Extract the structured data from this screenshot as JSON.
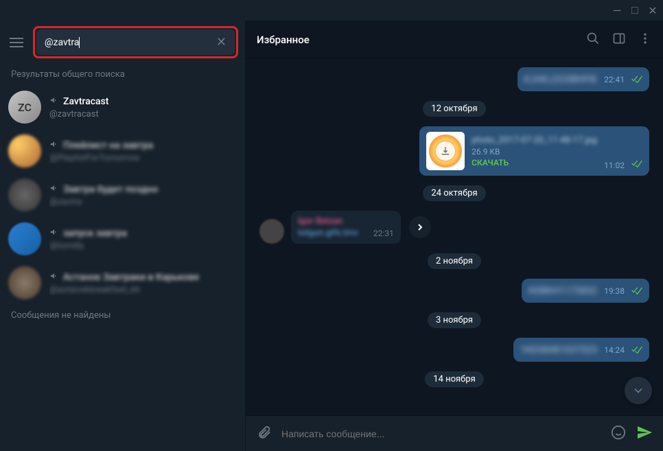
{
  "titlebar": {
    "min": "—",
    "max": "□",
    "close": "✕"
  },
  "search": {
    "value": "@zavtra",
    "clear": "✕"
  },
  "sidebar": {
    "results_header": "Результаты общего поиска",
    "no_messages": "Сообщения не найдены",
    "items": [
      {
        "title": "Zavtracast",
        "handle": "@zavtracast",
        "avatar_text": "ZC"
      },
      {
        "title": "Плейлист на завтра",
        "handle": "@PlaylistForTomorrow"
      },
      {
        "title": "Завтра будет поздно",
        "handle": "@zavtra"
      },
      {
        "title": "запуск завтра",
        "handle": "@tomilly"
      },
      {
        "title": "Астанок Завтраки в Карькове",
        "handle": "@astanokbreakfast_kh"
      }
    ]
  },
  "chat": {
    "title": "Избранное",
    "dates": {
      "d1": "12 октября",
      "d2": "24 октября",
      "d3": "2 ноября",
      "d4": "3 ноября",
      "d5": "14 ноября"
    },
    "messages": {
      "m0": {
        "text": "KJHKJ2O3BHFIE",
        "time": "22:41"
      },
      "m1": {
        "filename": "photo_2017-07-20_11-48-17.jpg",
        "size": "26.9 KB",
        "download": "СКАЧАТЬ",
        "time": "11:02"
      },
      "m2": {
        "sender": "Igor Belzan",
        "link": "totgun.gifs.tmv",
        "time": "22:31"
      },
      "m3": {
        "text": "KDBKH1175832",
        "time": "19:38"
      },
      "m4": {
        "text": "1KD38481037525",
        "time": "14:24"
      }
    },
    "composer": {
      "placeholder": "Написать сообщение..."
    }
  }
}
